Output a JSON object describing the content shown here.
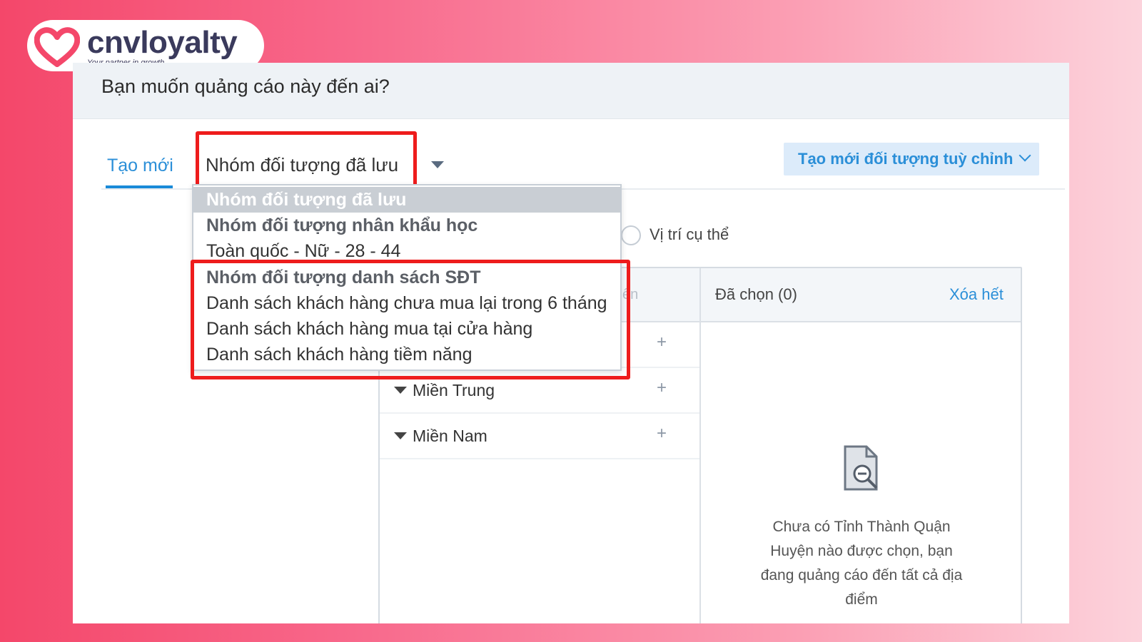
{
  "brand": {
    "name": "cnvloyalty",
    "tagline": "Your partner in growth",
    "color": "#f4476a"
  },
  "header": {
    "question": "Bạn muốn quảng cáo này đến ai?"
  },
  "tabs": {
    "new_label": "Tạo mới"
  },
  "audience_select": {
    "value": "Nhóm đối tượng đã lưu"
  },
  "custom_button": {
    "label": "Tạo mới đối tượng tuỳ chỉnh"
  },
  "location": {
    "specific_label": "Vị trí cụ thể"
  },
  "regions": {
    "search_hint": "ên",
    "selected_label": "Đã chọn (0)",
    "clear_all": "Xóa hết",
    "rows": [
      {
        "label": "",
        "plus": "+"
      },
      {
        "label": "Miền Trung",
        "plus": "+"
      },
      {
        "label": "Miền Nam",
        "plus": "+"
      }
    ],
    "empty_text": "Chưa có Tỉnh Thành Quận Huyện nào được chọn, bạn đang quảng cáo đến tất cả địa điểm"
  },
  "dropdown": {
    "items": [
      {
        "label": "Nhóm đối tượng đã lưu",
        "kind": "group-selected"
      },
      {
        "label": "Nhóm đối tượng nhân khẩu học",
        "kind": "group"
      },
      {
        "label": "Toàn quốc - Nữ - 28 - 44",
        "kind": "option"
      },
      {
        "label": "Nhóm đối tượng danh sách SĐT",
        "kind": "group"
      },
      {
        "label": "Danh sách khách hàng chưa mua lại trong 6 tháng",
        "kind": "option"
      },
      {
        "label": "Danh sách khách hàng mua tại cửa hàng",
        "kind": "option"
      },
      {
        "label": "Danh sách khách hàng tiềm năng",
        "kind": "option"
      }
    ]
  },
  "colors": {
    "highlight": "#ee1c1c",
    "accent": "#2b8fd8"
  }
}
